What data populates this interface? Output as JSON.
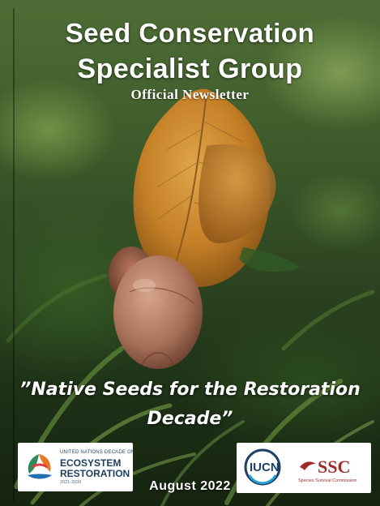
{
  "header": {
    "title_line1": "Seed Conservation",
    "title_line2": "Specialist Group",
    "subtitle": "Official Newsletter"
  },
  "tagline": {
    "line1": "”Native Seeds for the Restoration",
    "line2": "Decade”"
  },
  "logos": {
    "decade": {
      "line1": "UNITED NATIONS DECADE ON",
      "line2": "ECOSYSTEM",
      "line3": "RESTORATION",
      "line4": "2021-2030"
    },
    "iucn": "IUCN",
    "ssc": "SSC",
    "ssc_caption": "Species Survival Commission"
  },
  "footer": {
    "date": "August 2022"
  },
  "colors": {
    "title_text": "#ffffff",
    "iucn_blue": "#1f3f66",
    "ssc_red": "#9e2b2b"
  }
}
